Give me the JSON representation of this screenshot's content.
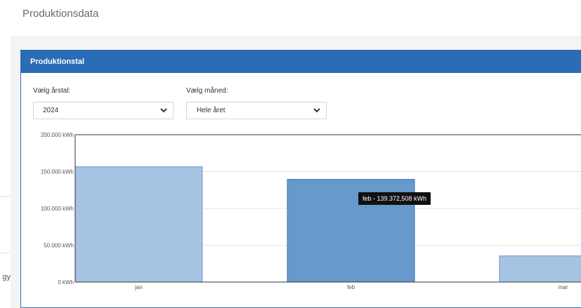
{
  "header": {
    "title": "Produktionsdata"
  },
  "sidebar": {
    "partial_text": "gy"
  },
  "panel": {
    "title": "Produktionstal"
  },
  "filters": {
    "year": {
      "label": "Vælg årstal:",
      "value": "2024"
    },
    "month": {
      "label": "Vælg måned:",
      "value": "Hele året"
    }
  },
  "chart_data": {
    "type": "bar",
    "categories": [
      "jan",
      "feb",
      "mar"
    ],
    "values": [
      156500,
      139372.508,
      35500
    ],
    "ylim": [
      0,
      200000
    ],
    "yticks": [
      "200.000 kWh",
      "150.000 kWh",
      "100.000 kWh",
      "50.000 kWh",
      "0 kWh"
    ],
    "grid": true,
    "highlighted_category": "feb",
    "colors": {
      "bar": "#a6c3e2",
      "bar_border": "#6f9bd0",
      "bar_highlight": "#6799cc",
      "bar_highlight_border": "#3c72b5",
      "grid": "#e4e4e4",
      "axis": "#333333"
    },
    "tooltip": "feb - 139.372,508 kWh"
  },
  "colors": {
    "accent": "#2a6db5",
    "top_accent": "#2fb34a"
  }
}
